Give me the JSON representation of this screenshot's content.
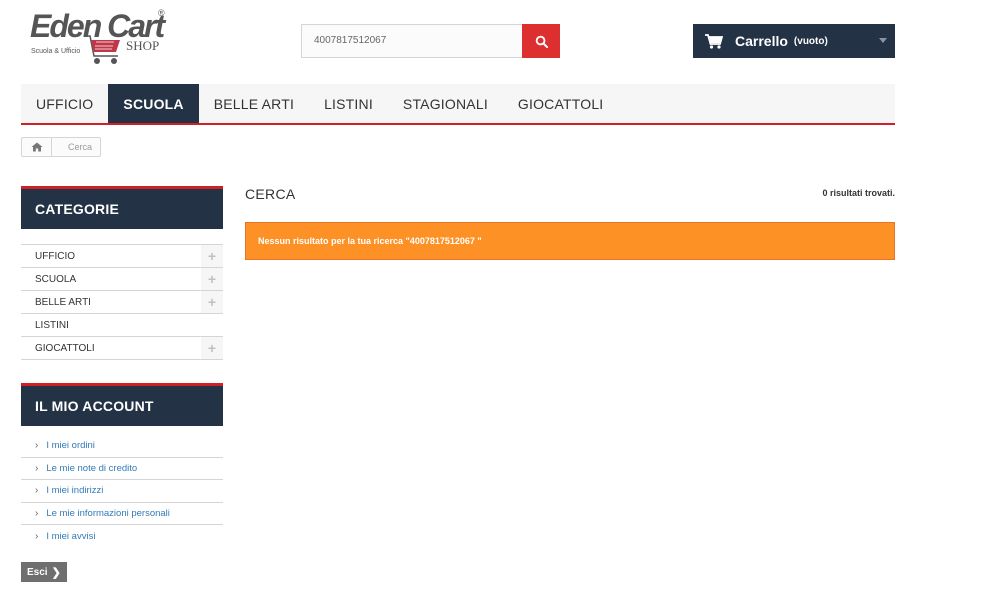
{
  "header": {
    "logo": {
      "main": "Eden Cart",
      "registered": "®",
      "sub": "Scuola & Ufficio",
      "shop": "SHOP"
    },
    "search": {
      "value": "4007817512067",
      "icon": "search-icon"
    },
    "cart": {
      "label": "Carrello",
      "status": "(vuoto)",
      "icon": "cart-icon"
    },
    "colors": {
      "accent": "#cd2027",
      "dark": "#243245",
      "search_btn": "#dd2f2f",
      "alert": "#fe9126"
    }
  },
  "nav": {
    "items": [
      {
        "label": "UFFICIO",
        "active": false
      },
      {
        "label": "SCUOLA",
        "active": true
      },
      {
        "label": "BELLE ARTI",
        "active": false
      },
      {
        "label": "LISTINI",
        "active": false
      },
      {
        "label": "STAGIONALI",
        "active": false
      },
      {
        "label": "GIOCATTOLI",
        "active": false
      }
    ]
  },
  "breadcrumb": {
    "home_icon": "home-icon",
    "current": "Cerca"
  },
  "sidebar": {
    "categories": {
      "title": "CATEGORIE",
      "items": [
        {
          "label": "UFFICIO",
          "expandable": true
        },
        {
          "label": "SCUOLA",
          "expandable": true
        },
        {
          "label": "BELLE ARTI",
          "expandable": true
        },
        {
          "label": "LISTINI",
          "expandable": false
        },
        {
          "label": "GIOCATTOLI",
          "expandable": true
        }
      ]
    },
    "account": {
      "title": "IL MIO ACCOUNT",
      "items": [
        {
          "label": "I miei ordini"
        },
        {
          "label": "Le mie note di credito"
        },
        {
          "label": "I miei indirizzi"
        },
        {
          "label": "Le mie informazioni personali"
        },
        {
          "label": "I miei avvisi"
        }
      ],
      "arrow": "›",
      "plus": "+",
      "logout": {
        "label": "Esci",
        "chevron": "❯"
      }
    }
  },
  "main": {
    "heading": "CERCA",
    "results": "0 risultati trovati.",
    "alert": "Nessun risultato per la tua ricerca \"4007817512067 \""
  }
}
